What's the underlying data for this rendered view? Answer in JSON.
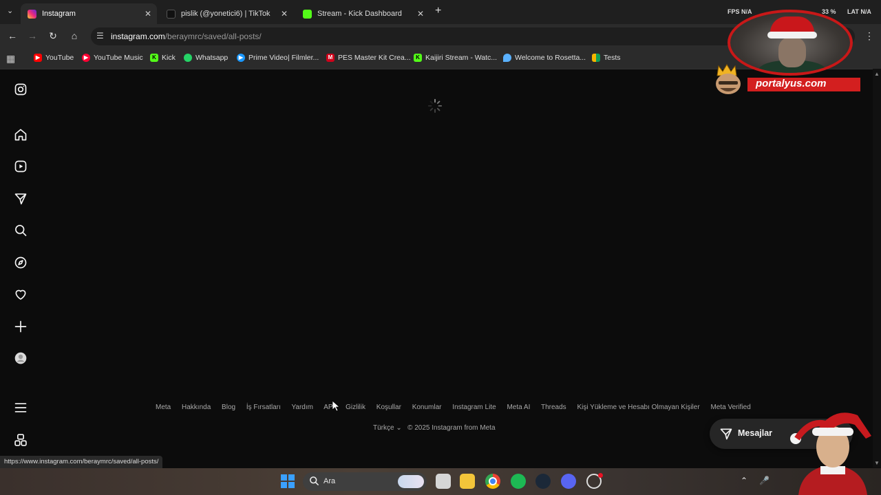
{
  "tabs": [
    {
      "title": "Instagram",
      "active": true,
      "favicon_color": "#d6249f"
    },
    {
      "title": "pislik (@yonetici6) | TikTok",
      "active": false,
      "favicon_color": "#111111"
    },
    {
      "title": "Stream - Kick Dashboard",
      "active": false,
      "favicon_color": "#53fc18"
    }
  ],
  "system_indicators": {
    "fps_label": "FPS",
    "fps_value": "N/A",
    "pct": "33 %",
    "lat_label": "LAT",
    "lat_value": "N/A"
  },
  "address_bar": {
    "host": "instagram.com",
    "path": "/beraymrc/saved/all-posts/"
  },
  "bookmarks": [
    {
      "label": "YouTube",
      "icon": "youtube-icon",
      "color": "#ff0000"
    },
    {
      "label": "YouTube Music",
      "icon": "youtube-music-icon",
      "color": "#ff0033"
    },
    {
      "label": "Kick",
      "icon": "kick-icon",
      "color": "#53fc18"
    },
    {
      "label": "Whatsapp",
      "icon": "whatsapp-icon",
      "color": "#25d366"
    },
    {
      "label": "Prime Video| Filmler...",
      "icon": "prime-video-icon",
      "color": "#1a98ff"
    },
    {
      "label": "PES Master Kit Crea...",
      "icon": "pes-master-icon",
      "color": "#d0021b"
    },
    {
      "label": "Kaijiri Stream - Watc...",
      "icon": "kick-icon",
      "color": "#53fc18"
    },
    {
      "label": "Welcome to Rosetta...",
      "icon": "rosetta-icon",
      "color": "#5ab1ff"
    },
    {
      "label": "Tests",
      "icon": "tests-icon",
      "color": "#f4b400"
    }
  ],
  "footer": {
    "links": [
      "Meta",
      "Hakkında",
      "Blog",
      "İş Fırsatları",
      "Yardım",
      "API",
      "Gizlilik",
      "Koşullar",
      "Konumlar",
      "Instagram Lite",
      "Meta AI",
      "Threads",
      "Kişi Yükleme ve Hesabı Olmayan Kişiler",
      "Meta Verified"
    ],
    "language": "Türkçe",
    "copyright": "© 2025 Instagram from Meta"
  },
  "messages_button": {
    "label": "Mesajlar"
  },
  "status_url": "https://www.instagram.com/beraymrc/saved/all-posts/",
  "taskbar": {
    "search_placeholder": "Ara"
  },
  "overlay": {
    "brand_text": "portalyus.com"
  }
}
